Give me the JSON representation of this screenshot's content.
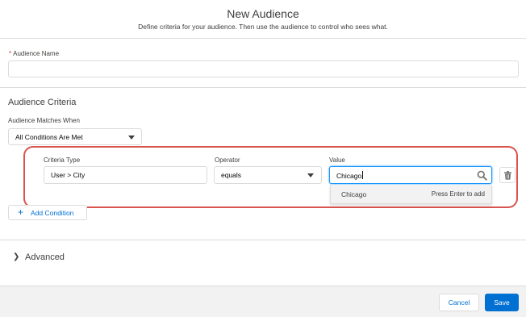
{
  "header": {
    "title": "New Audience",
    "subtitle": "Define criteria for your audience. Then use the audience to control who sees what."
  },
  "audience_name": {
    "required_marker": "*",
    "label": "Audience Name",
    "value": ""
  },
  "criteria": {
    "heading": "Audience Criteria",
    "matches_label": "Audience Matches When",
    "matches_value": "All Conditions Are Met",
    "condition": {
      "criteria_type_label": "Criteria Type",
      "criteria_type_value": "User > City",
      "operator_label": "Operator",
      "operator_value": "equals",
      "value_label": "Value",
      "value_value": "Chicago",
      "suggestion": "Chicago",
      "suggestion_hint": "Press Enter to add"
    },
    "add_condition_label": "Add Condition"
  },
  "advanced": {
    "label": "Advanced"
  },
  "footer": {
    "cancel_label": "Cancel",
    "save_label": "Save"
  },
  "colors": {
    "brand_blue": "#0070d2",
    "focus_blue": "#1b96ff",
    "highlight_red": "#d9534f",
    "required_red": "#c23934"
  },
  "icons": [
    "search-icon",
    "trash-icon",
    "chevron-down-icon",
    "chevron-right-icon",
    "plus-icon"
  ]
}
